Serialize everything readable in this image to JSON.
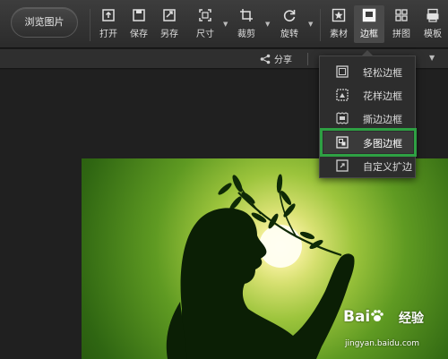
{
  "toolbar": {
    "browse_label": "浏览图片",
    "tools": [
      {
        "label": "打开",
        "icon": "open-icon"
      },
      {
        "label": "保存",
        "icon": "save-icon"
      },
      {
        "label": "另存",
        "icon": "save-as-icon"
      },
      {
        "label": "尺寸",
        "icon": "resize-icon"
      },
      {
        "label": "裁剪",
        "icon": "crop-icon"
      },
      {
        "label": "旋转",
        "icon": "rotate-icon"
      },
      {
        "label": "素材",
        "icon": "material-icon"
      },
      {
        "label": "边框",
        "icon": "border-icon",
        "active": true
      },
      {
        "label": "拼图",
        "icon": "collage-icon"
      },
      {
        "label": "模板",
        "icon": "template-icon"
      }
    ]
  },
  "subbar": {
    "share_label": "分享"
  },
  "border_menu": {
    "items": [
      {
        "label": "轻松边框",
        "icon": "simple-border-icon"
      },
      {
        "label": "花样边框",
        "icon": "pattern-border-icon"
      },
      {
        "label": "撕边边框",
        "icon": "torn-border-icon"
      },
      {
        "label": "多图边框",
        "icon": "multi-image-border-icon",
        "highlighted": true
      },
      {
        "label": "自定义扩边",
        "icon": "custom-expand-icon"
      }
    ],
    "highlight_color": "#2ea043"
  },
  "watermark": {
    "brand": "Bai",
    "brand_suffix": "du",
    "product": "经验",
    "url": "jingyan.baidu.com"
  }
}
